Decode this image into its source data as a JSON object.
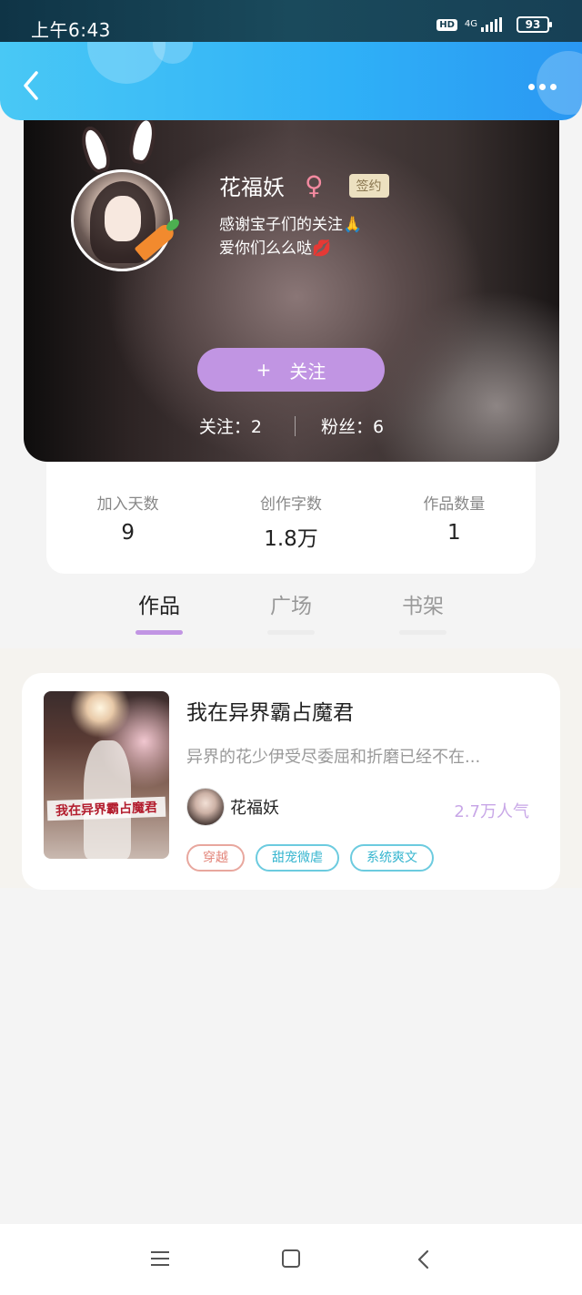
{
  "status_bar": {
    "time": "上午6:43",
    "hd": "HD",
    "network": "4G",
    "battery": "93"
  },
  "header": {
    "back_icon": "chevron-left-icon",
    "more_icon": "more-dots-icon"
  },
  "profile": {
    "name": "花福妖",
    "gender_symbol": "♀",
    "signed_badge": "签约",
    "bio_line1": "感谢宝子们的关注",
    "bio_emoji1": "🙏",
    "bio_line2": "爱你们么么哒",
    "bio_emoji2": "💋",
    "follow_plus": "+",
    "follow_label": "关注",
    "following_text": "关注：2",
    "fans_text": "粉丝：6"
  },
  "stats": [
    {
      "label": "加入天数",
      "value": "9"
    },
    {
      "label": "创作字数",
      "value": "1.8万"
    },
    {
      "label": "作品数量",
      "value": "1"
    }
  ],
  "tabs": [
    {
      "label": "作品",
      "active": true
    },
    {
      "label": "广场",
      "active": false
    },
    {
      "label": "书架",
      "active": false
    }
  ],
  "book": {
    "cover_title": "我在异界霸占魔君",
    "title": "我在异界霸占魔君",
    "description": "异界的花少伊受尽委屈和折磨已经不在...",
    "author": "花福妖",
    "popularity": "2.7万人气",
    "tags": [
      "穿越",
      "甜宠微虐",
      "系统爽文"
    ]
  },
  "colors": {
    "header_blue": "#2fb0f7",
    "accent_purple": "#c195e3",
    "tag_red": "#e3867b",
    "tag_cyan": "#35b5cf"
  }
}
